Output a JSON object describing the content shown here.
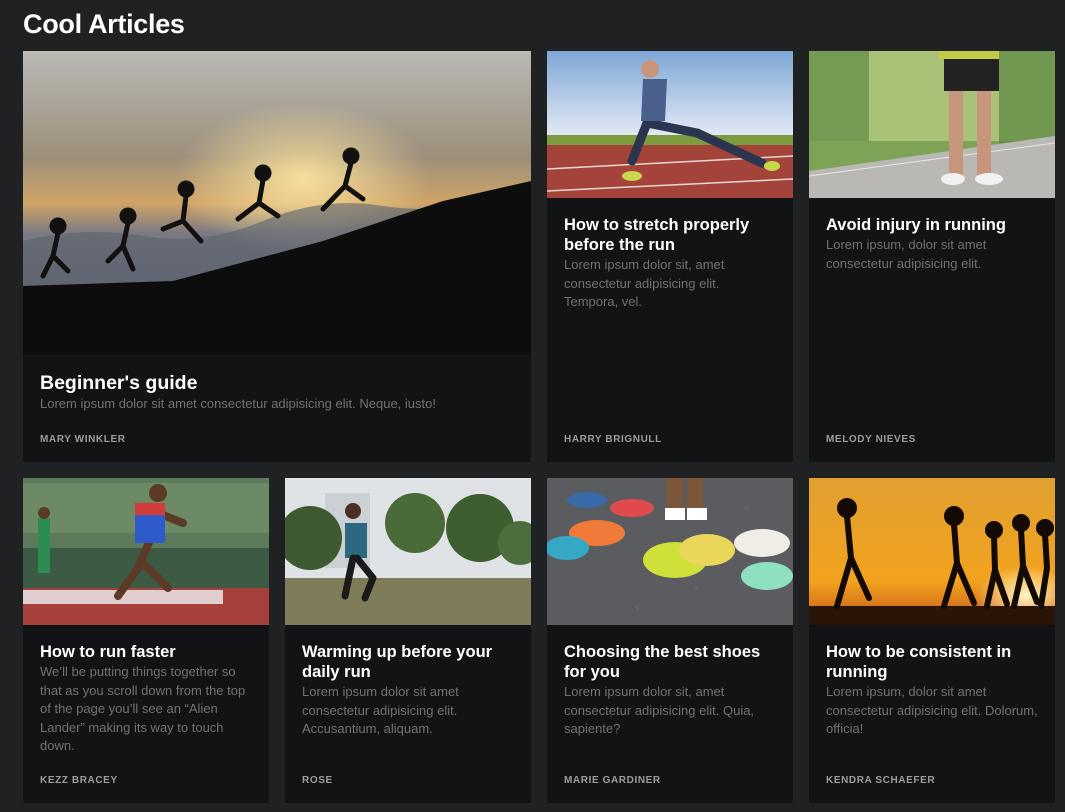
{
  "page": {
    "title": "Cool Articles"
  },
  "articles": [
    {
      "title": "Beginner's guide",
      "excerpt": "Lorem ipsum dolor sit amet consectetur adipisicing elit. Neque, iusto!",
      "author": "MARY WINKLER",
      "image": "runners-silhouette-hill-sunset-photo"
    },
    {
      "title": "How to stretch properly before the run",
      "excerpt": "Lorem ipsum dolor sit, amet consectetur adipisicing elit. Tempora, vel.",
      "author": "HARRY BRIGNULL",
      "image": "runner-stretching-on-track-photo"
    },
    {
      "title": "Avoid injury in running",
      "excerpt": "Lorem ipsum, dolor sit amet consectetur adipisicing elit.",
      "author": "MELODY NIEVES",
      "image": "runner-holding-knee-photo"
    },
    {
      "title": "How to run faster",
      "excerpt": "We’ll be putting things together so that as you scroll down from the top of the page you’ll see an “Alien Lander” making its way to touch down.",
      "author": "KEZZ BRACEY",
      "image": "sprinter-relay-race-photo"
    },
    {
      "title": "Warming up before your daily run",
      "excerpt": "Lorem ipsum dolor sit amet consectetur adipisicing elit. Accusantium, aliquam.",
      "author": "ROSE",
      "image": "man-warming-up-in-park-photo"
    },
    {
      "title": "Choosing the best shoes for you",
      "excerpt": "Lorem ipsum dolor sit, amet consectetur adipisicing elit. Quia, sapiente?",
      "author": "MARIE GARDINER",
      "image": "running-shoes-on-asphalt-photo"
    },
    {
      "title": "How to be consistent in running",
      "excerpt": "Lorem ipsum, dolor sit amet consectetur adipisicing elit. Dolorum, officia!",
      "author": "KENDRA SCHAEFER",
      "image": "group-running-at-sunset-photo"
    }
  ]
}
